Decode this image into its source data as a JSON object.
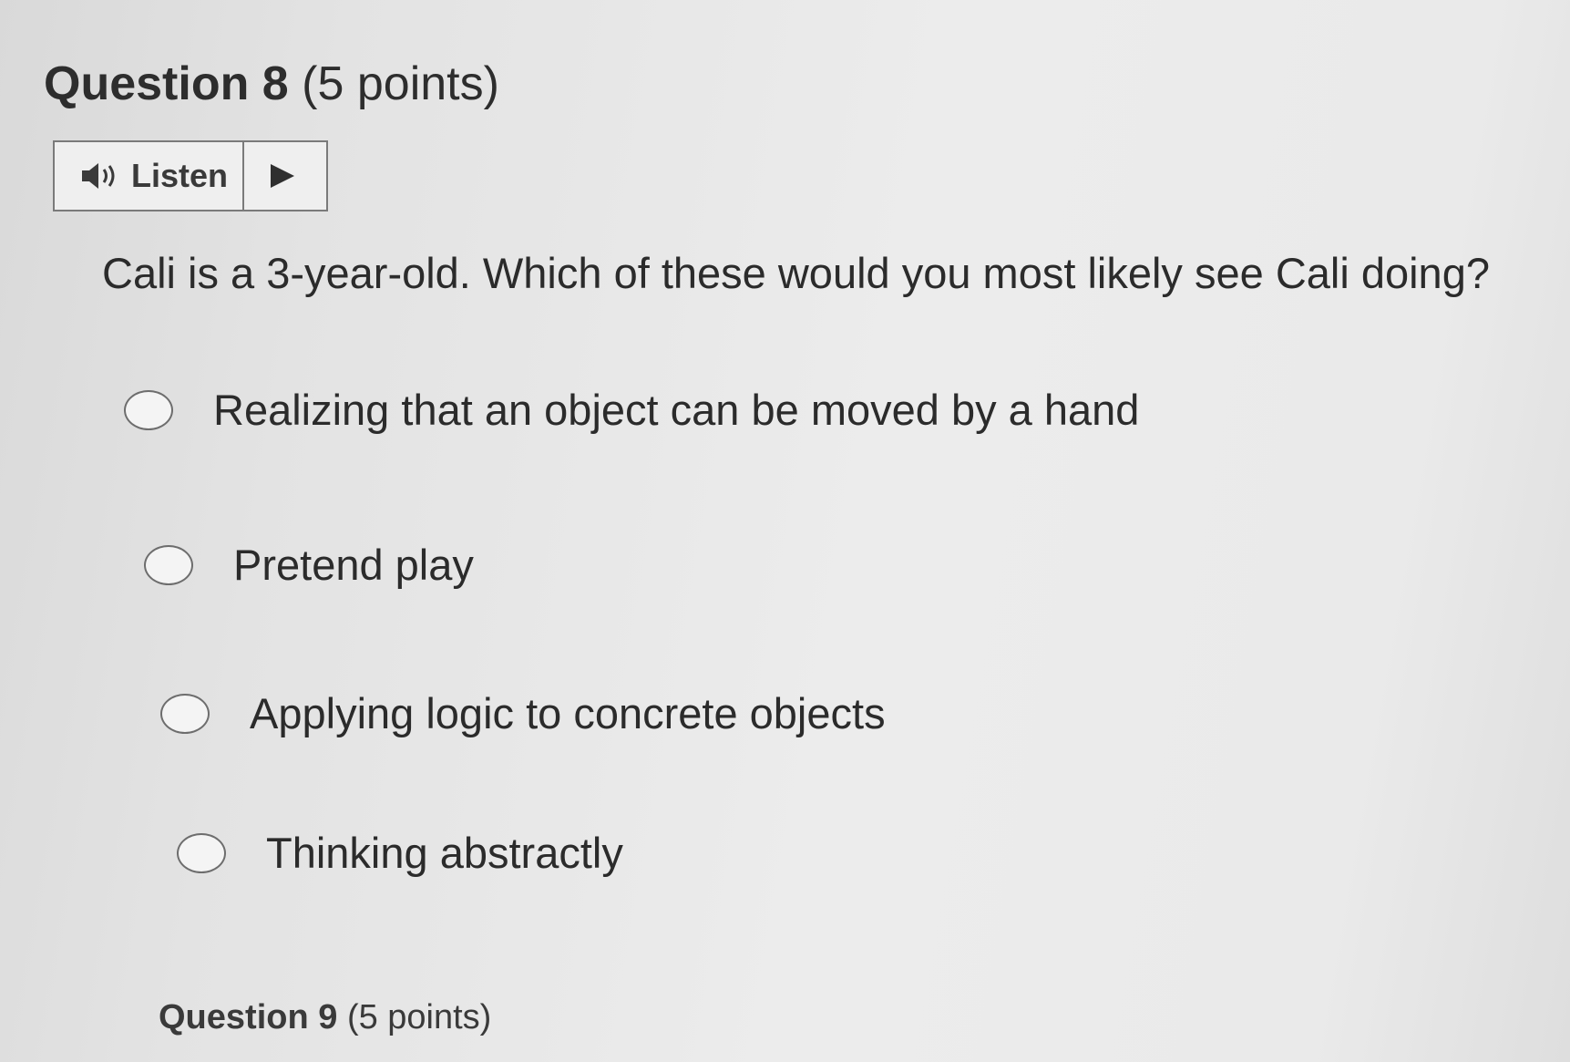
{
  "question": {
    "number": "Question 8",
    "points": "(5 points)",
    "text": "Cali is a 3-year-old. Which of these would you most likely see Cali doing?",
    "options": [
      {
        "label": "Realizing that an object can be moved by a hand"
      },
      {
        "label": "Pretend play"
      },
      {
        "label": "Applying logic to concrete objects"
      },
      {
        "label": "Thinking abstractly"
      }
    ]
  },
  "listen": {
    "label": "Listen",
    "speaker_icon": "speaker-icon",
    "play_icon": "play-icon"
  },
  "next_question": {
    "number": "Question 9",
    "points": "(5 points)"
  }
}
